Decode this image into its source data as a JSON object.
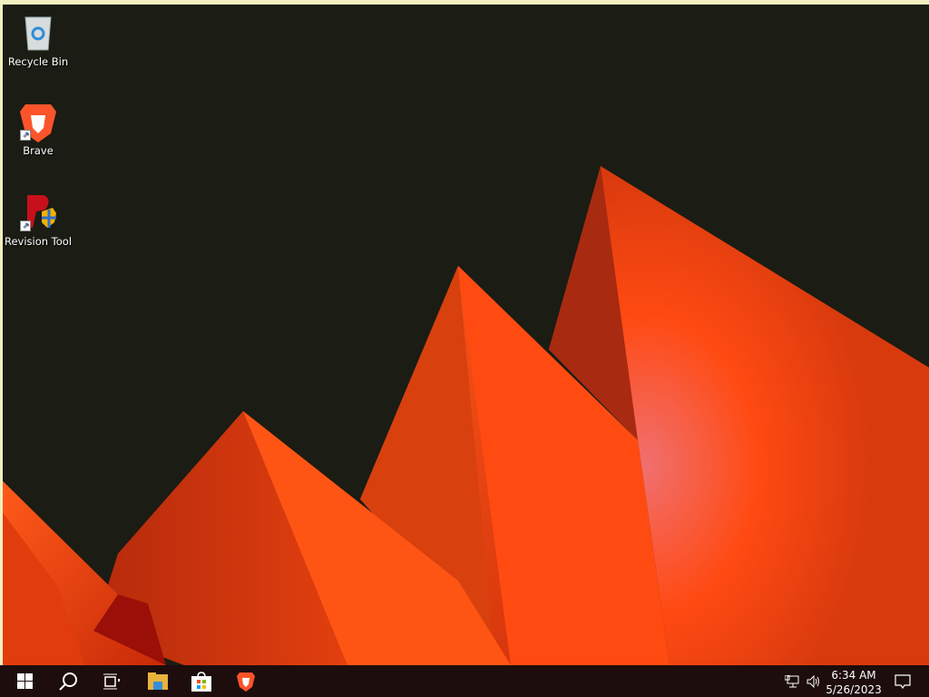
{
  "desktop": {
    "icons": [
      {
        "label": "Recycle Bin",
        "icon": "recycle-bin-icon"
      },
      {
        "label": "Brave",
        "icon": "brave-icon"
      },
      {
        "label": "Revision Tool",
        "icon": "revision-tool-icon"
      }
    ]
  },
  "taskbar": {
    "items": [
      "start",
      "search",
      "task-view",
      "file-explorer",
      "microsoft-store",
      "brave"
    ],
    "clock": {
      "time": "6:34 AM",
      "date": "5/26/2023"
    }
  },
  "colors": {
    "wallpaper_bg": "#1b1c13",
    "accent": "#ff4a12",
    "taskbar": "#1e0d0d"
  }
}
